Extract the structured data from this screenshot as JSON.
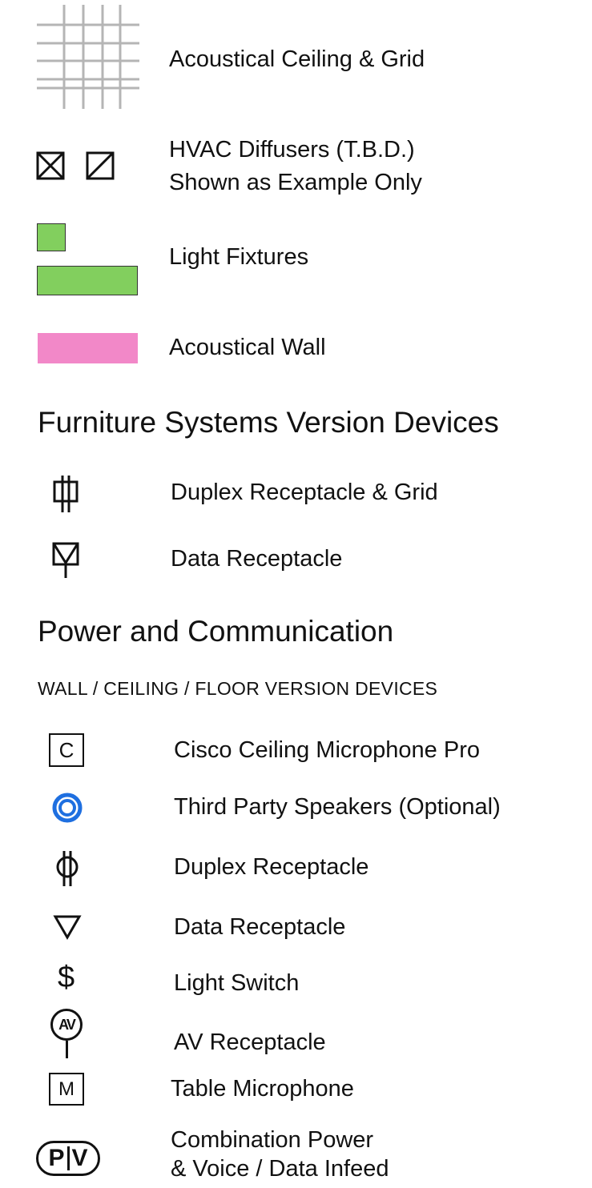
{
  "legend_top": {
    "ceiling_grid": "Acoustical Ceiling & Grid",
    "hvac_line1": "HVAC Diffusers (T.B.D.)",
    "hvac_line2": "Shown as Example Only",
    "light_fixtures": "Light Fixtures",
    "acoustical_wall": "Acoustical Wall"
  },
  "furniture_section": {
    "heading": "Furniture Systems Version Devices",
    "duplex_grid": "Duplex Receptacle & Grid",
    "data_receptacle": "Data Receptacle"
  },
  "power_section": {
    "heading": "Power and Communication",
    "subheading": "WALL / CEILING / FLOOR VERSION DEVICES",
    "ceiling_mic_symbol": "C",
    "ceiling_mic": "Cisco Ceiling Microphone Pro",
    "speakers": "Third Party Speakers (Optional)",
    "duplex": "Duplex Receptacle",
    "data": "Data Receptacle",
    "light_switch_symbol": "$",
    "light_switch": "Light Switch",
    "av_symbol": "AV",
    "av_receptacle": "AV Receptacle",
    "table_mic_symbol": "M",
    "table_mic": "Table Microphone",
    "pv_symbol_p": "P",
    "pv_symbol_v": "V",
    "combo_line1": "Combination Power",
    "combo_line2": "& Voice / Data Infeed"
  },
  "colors": {
    "grid_gray": "#b5b5b5",
    "light_fixture_green": "#82cf5e",
    "acoustical_wall_pink": "#f288c8",
    "speaker_blue": "#1e6fe0"
  }
}
